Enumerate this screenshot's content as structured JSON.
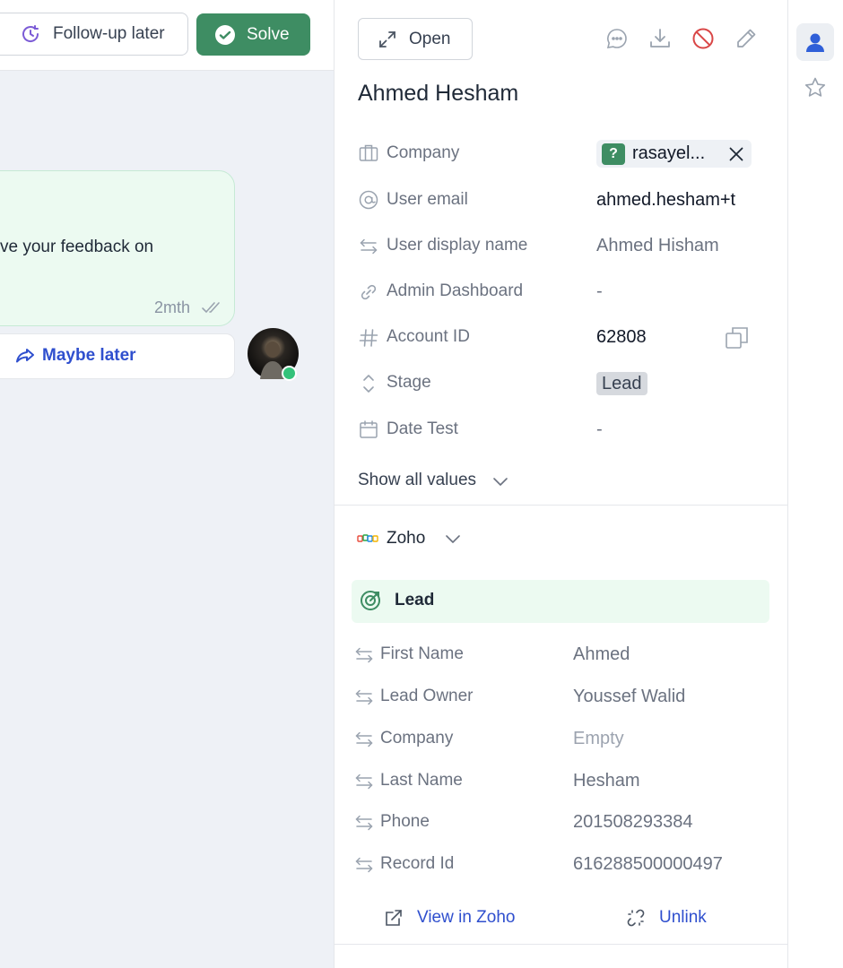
{
  "toolbar": {
    "follow_up_label": "Follow-up later",
    "solve_label": "Solve"
  },
  "conversation": {
    "message_text": "ve your feedback on",
    "message_time": "2mth",
    "maybe_later_label": "Maybe later"
  },
  "panel": {
    "open_label": "Open",
    "contact_name": "Ahmed Hesham",
    "attributes": {
      "company": {
        "label": "Company",
        "value": "rasayel...",
        "badge": "?"
      },
      "user_email": {
        "label": "User email",
        "value": "ahmed.hesham+t"
      },
      "display_name": {
        "label": "User display name",
        "value": "Ahmed Hisham"
      },
      "admin_dashboard": {
        "label": "Admin Dashboard",
        "value": "-"
      },
      "account_id": {
        "label": "Account ID",
        "value": "62808"
      },
      "stage": {
        "label": "Stage",
        "value": "Lead"
      },
      "date_test": {
        "label": "Date Test",
        "value": "-"
      }
    },
    "show_all_label": "Show all values"
  },
  "zoho": {
    "title": "Zoho",
    "record_type": "Lead",
    "fields": [
      {
        "label": "First Name",
        "value": "Ahmed"
      },
      {
        "label": "Lead Owner",
        "value": "Youssef Walid"
      },
      {
        "label": "Company",
        "value": "Empty"
      },
      {
        "label": "Last Name",
        "value": "Hesham"
      },
      {
        "label": "Phone",
        "value": "201508293384"
      },
      {
        "label": "Record Id",
        "value": "616288500000497"
      }
    ],
    "view_label": "View in Zoho",
    "unlink_label": "Unlink"
  },
  "colors": {
    "accent_green": "#3e8d63",
    "link_blue": "#2f4fce",
    "danger_red": "#d94646"
  }
}
